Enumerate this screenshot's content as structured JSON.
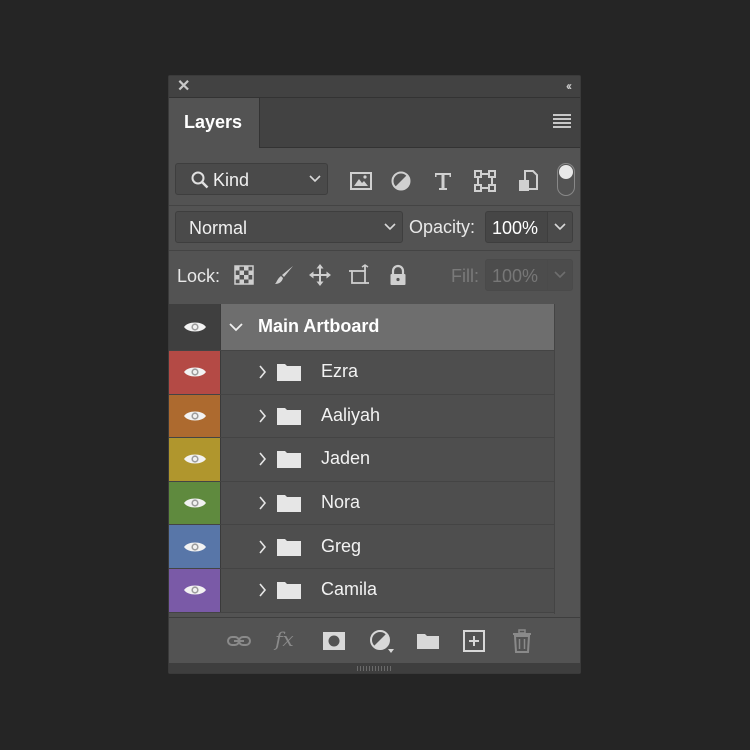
{
  "panel": {
    "tab_label": "Layers",
    "filter": {
      "kind_label": "Kind"
    },
    "blend": {
      "mode": "Normal",
      "opacity_label": "Opacity:",
      "opacity_value": "100%"
    },
    "lock": {
      "label": "Lock:",
      "fill_label": "Fill:",
      "fill_value": "100%"
    }
  },
  "layers": [
    {
      "name": "Main Artboard",
      "type": "artboard",
      "color": "#3f3f3f",
      "visible": true,
      "expanded": true
    },
    {
      "name": "Ezra",
      "type": "group",
      "color": "#b44a45",
      "visible": true,
      "expanded": false
    },
    {
      "name": "Aaliyah",
      "type": "group",
      "color": "#ad6a2f",
      "visible": true,
      "expanded": false
    },
    {
      "name": "Jaden",
      "type": "group",
      "color": "#b0962d",
      "visible": true,
      "expanded": false
    },
    {
      "name": "Nora",
      "type": "group",
      "color": "#5f8a3e",
      "visible": true,
      "expanded": false
    },
    {
      "name": "Greg",
      "type": "group",
      "color": "#5876a8",
      "visible": true,
      "expanded": false
    },
    {
      "name": "Camila",
      "type": "group",
      "color": "#7a5aa7",
      "visible": true,
      "expanded": false
    }
  ],
  "icons": {
    "topbar": [
      "close-icon",
      "collapse-icon"
    ],
    "panel_menu": "hamburger-menu-icon",
    "filters": [
      "image-filter-icon",
      "adjustment-filter-icon",
      "type-filter-icon",
      "shape-filter-icon",
      "smart-object-filter-icon"
    ],
    "locks": [
      "lock-transparent-pixels-icon",
      "lock-image-pixels-icon",
      "lock-position-icon",
      "lock-artboard-icon",
      "lock-all-icon"
    ],
    "bottom": [
      "link-layers-icon",
      "fx-icon",
      "add-mask-icon",
      "new-adjustment-layer-icon",
      "new-group-icon",
      "new-layer-icon",
      "delete-layer-icon"
    ]
  },
  "colors": {
    "panel_bg": "#535353",
    "chrome_bg": "#424242",
    "app_bg": "#252525",
    "artboard_row_bg": "#6e6e6e"
  }
}
